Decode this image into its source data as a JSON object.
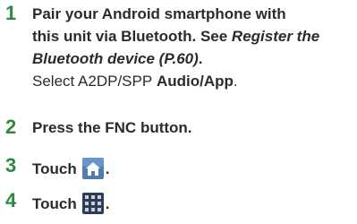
{
  "steps": [
    {
      "number": "1",
      "lines": [
        "Pair your Android smartphone with",
        "this unit via Bluetooth. See "
      ],
      "ref_part1": "Register the",
      "ref_part2": "Bluetooth device (P.60)",
      "ref_end": ".",
      "select_prefix": "Select ",
      "select_mid": "A2DP/SPP",
      "select_bold": "Audio/App",
      "select_end": "."
    },
    {
      "number": "2",
      "pre": "Press the ",
      "key": "FNC",
      "post": " button."
    },
    {
      "number": "3",
      "text": "Touch",
      "end": ".",
      "icon": "home-icon"
    },
    {
      "number": "4",
      "text": "Touch",
      "end": ".",
      "icon": "app-grid-icon"
    }
  ],
  "colors": {
    "step_number": "#2b8a3e",
    "home_icon": "#4f7db2",
    "grid_icon": "#2e3e57"
  }
}
